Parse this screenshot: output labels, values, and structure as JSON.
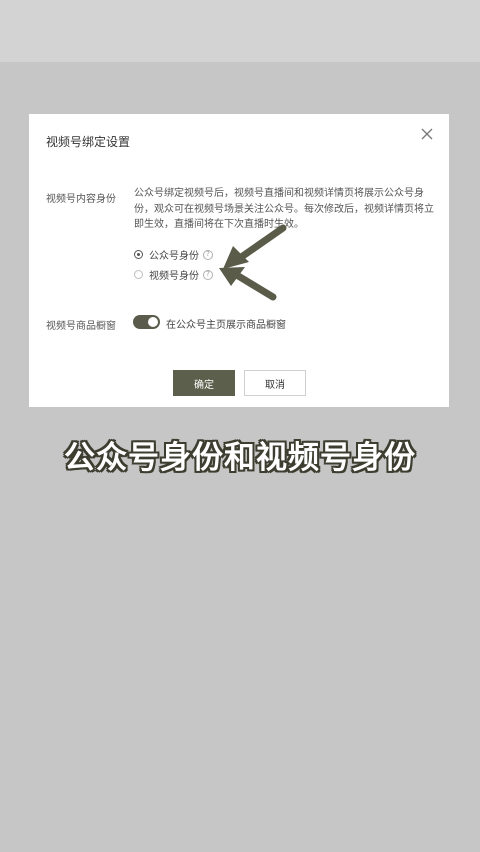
{
  "dialog": {
    "title": "视频号绑定设置",
    "content_identity": {
      "label": "视频号内容身份",
      "description": "公众号绑定视频号后，视频号直播间和视频详情页将展示公众号身份，观众可在视频号场景关注公众号。每次修改后，视频详情页将立即生效，直播间将在下次直播时生效。",
      "options": [
        {
          "label": "公众号身份",
          "selected": true
        },
        {
          "label": "视频号身份",
          "selected": false
        }
      ]
    },
    "product_window": {
      "label": "视频号商品橱窗",
      "toggle_label": "在公众号主页展示商品橱窗",
      "enabled": true
    },
    "buttons": {
      "confirm": "确定",
      "cancel": "取消"
    }
  },
  "caption": "公众号身份和视频号身份",
  "colors": {
    "overlay": "#c6c6c6",
    "primary": "#5c5f4c",
    "arrow": "#5a5c49"
  }
}
